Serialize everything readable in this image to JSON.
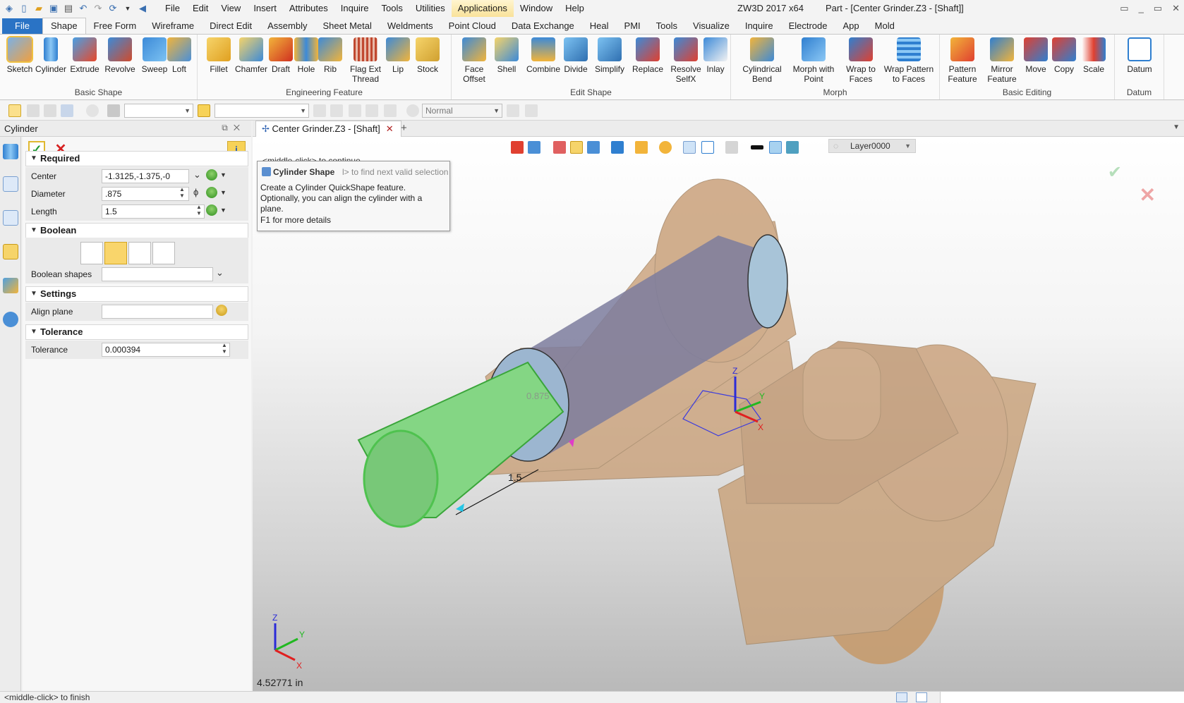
{
  "titlebar": {
    "app_title": "ZW3D 2017  x64",
    "doc_title": "Part - [Center Grinder.Z3 - [Shaft]]",
    "menu": [
      "File",
      "Edit",
      "View",
      "Insert",
      "Attributes",
      "Inquire",
      "Tools",
      "Utilities",
      "Applications",
      "Window",
      "Help"
    ],
    "window_buttons": [
      "▭",
      "_",
      "▭",
      "✕"
    ]
  },
  "ribbon_tabs": [
    "File",
    "Shape",
    "Free Form",
    "Wireframe",
    "Direct Edit",
    "Assembly",
    "Sheet Metal",
    "Weldments",
    "Point Cloud",
    "Data Exchange",
    "Heal",
    "PMI",
    "Tools",
    "Visualize",
    "Inquire",
    "Electrode",
    "App",
    "Mold"
  ],
  "ribbon": {
    "groups": [
      {
        "label": "Basic Shape",
        "buttons": [
          "Sketch",
          "Cylinder",
          "Extrude",
          "Revolve",
          "Sweep",
          "Loft"
        ]
      },
      {
        "label": "Engineering Feature",
        "buttons": [
          "Fillet",
          "Chamfer",
          "Draft",
          "Hole",
          "Rib",
          "Flag Ext Thread",
          "Lip",
          "Stock"
        ]
      },
      {
        "label": "Edit Shape",
        "buttons": [
          "Face Offset",
          "Shell",
          "Combine",
          "Divide",
          "Simplify",
          "Replace",
          "Resolve SelfX",
          "Inlay"
        ]
      },
      {
        "label": "Morph",
        "buttons": [
          "Cylindrical Bend",
          "Morph with Point",
          "Wrap to Faces",
          "Wrap Pattern to Faces"
        ]
      },
      {
        "label": "Basic Editing",
        "buttons": [
          "Pattern Feature",
          "Mirror Feature",
          "Move",
          "Copy",
          "Scale"
        ]
      },
      {
        "label": "Datum",
        "buttons": [
          "Datum"
        ]
      }
    ]
  },
  "toolbar": {
    "render_mode": "Normal"
  },
  "panel": {
    "title": "Cylinder",
    "required": {
      "header": "Required",
      "center_label": "Center",
      "center_value": "-1.3125,-1.375,-0",
      "diameter_label": "Diameter",
      "diameter_value": ".875",
      "length_label": "Length",
      "length_value": "1.5"
    },
    "boolean": {
      "header": "Boolean",
      "shapes_label": "Boolean shapes",
      "shapes_value": ""
    },
    "settings": {
      "header": "Settings",
      "align_label": "Align plane",
      "align_value": ""
    },
    "tolerance": {
      "header": "Tolerance",
      "label": "Tolerance",
      "value": "0.000394"
    }
  },
  "doc_tab": {
    "label": "Center Grinder.Z3 - [Shaft]"
  },
  "viewport": {
    "layer": "Layer0000",
    "prompt_continue": "<middle-click> to continue",
    "prompt_find_fragment": "l> to find next valid selection",
    "tooltip_title": "Cylinder Shape",
    "tooltip_body": "Create a Cylinder QuickShape feature.  Optionally, you can align the cylinder with a plane.",
    "tooltip_help": "F1 for more details",
    "dim_length": "1.5",
    "dim_diameter": "0.875",
    "distance_readout": "4.52771 in",
    "axis_x": "X",
    "axis_y": "Y",
    "axis_z": "Z"
  },
  "status": {
    "text": "<middle-click> to finish"
  }
}
